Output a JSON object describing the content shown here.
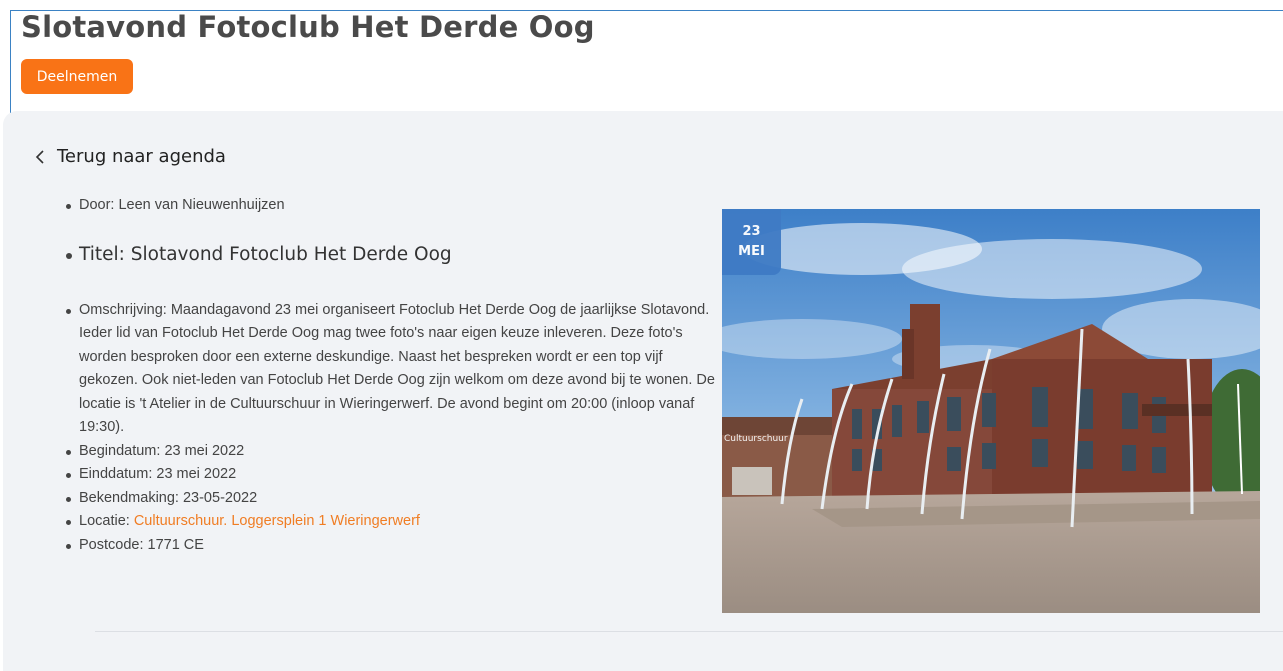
{
  "header": {
    "title": "Slotavond Fotoclub Het Derde Oog",
    "join_label": "Deelnemen"
  },
  "back": {
    "label": "Terug naar agenda",
    "icon": "chevron-left-icon"
  },
  "details": {
    "author": "Door: Leen van Nieuwenhuijzen",
    "title": "Titel: Slotavond Fotoclub Het Derde Oog",
    "description": "Omschrijving: Maandagavond 23 mei organiseert Fotoclub Het Derde Oog de jaarlijkse Slotavond. Ieder lid van Fotoclub Het Derde Oog mag twee foto's naar eigen keuze inleveren. Deze foto's worden besproken door een externe deskundige. Naast het bespreken wordt er een top vijf gekozen. Ook niet-leden van Fotoclub Het Derde Oog zijn welkom om deze avond bij te wonen. De locatie is 't Atelier in de Cultuurschuur in Wieringerwerf. De avond begint om 20:00 (inloop vanaf 19:30).",
    "start_date": "Begindatum: 23 mei 2022",
    "end_date": "Einddatum: 23 mei 2022",
    "announcement": "Bekendmaking: 23-05-2022",
    "location_label": "Locatie: ",
    "location_value": "Cultuurschuur. Loggersplein 1 Wieringerwerf",
    "postcode": "Postcode: 1771 CE"
  },
  "badge": {
    "day": "23",
    "month": "MEI"
  },
  "photo": {
    "sign_text": "Cultuurschuur"
  },
  "colors": {
    "accent": "#f97316",
    "badge": "#3f7bc5",
    "panel": "#f1f3f6"
  }
}
